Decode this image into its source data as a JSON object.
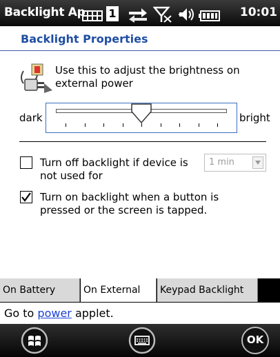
{
  "statusbar": {
    "app_title": "Backlight Ap",
    "clock": "10:01",
    "sim_number": "1",
    "icons": [
      "battery-grid-icon",
      "sim-icon",
      "sync-arrows-icon",
      "no-signal-icon",
      "volume-icon",
      "battery-icon"
    ]
  },
  "header": {
    "title": "Backlight Properties"
  },
  "main": {
    "description": "Use this to adjust the brightness on external power",
    "slider": {
      "min_label": "dark",
      "max_label": "bright",
      "level_fraction": 0.5,
      "ticks": 9
    },
    "options": [
      {
        "label": "Turn off backlight if device is not used for",
        "checked": false
      },
      {
        "label": "Turn on backlight when a button is pressed or the screen is tapped.",
        "checked": true
      }
    ],
    "timeout": {
      "value": "1 min"
    }
  },
  "tabs": [
    {
      "label": "On Battery",
      "active": false
    },
    {
      "label": "On External",
      "active": true
    },
    {
      "label": "Keypad Backlight",
      "active": false
    }
  ],
  "footer_link": {
    "prefix": "Go to ",
    "link": "power",
    "suffix": " applet."
  },
  "softkeys": [
    "windows-start-icon",
    "keyboard-icon",
    "ok-button"
  ],
  "softkey_ok_label": "OK",
  "colors": {
    "accent": "#1f4ea3",
    "link": "#1a3fd6",
    "slider_border": "#3a6fc0"
  }
}
